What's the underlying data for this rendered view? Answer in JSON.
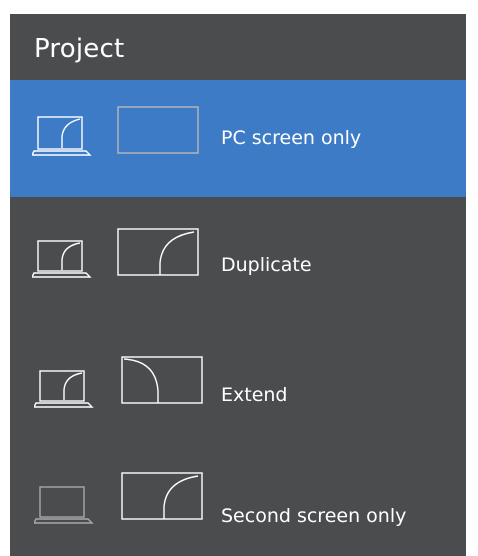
{
  "panel": {
    "title": "Project"
  },
  "options": [
    {
      "label": "PC screen only",
      "selected": true,
      "icon": "pc-screen-only-icon"
    },
    {
      "label": "Duplicate",
      "selected": false,
      "icon": "duplicate-icon"
    },
    {
      "label": "Extend",
      "selected": false,
      "icon": "extend-icon"
    },
    {
      "label": "Second screen only",
      "selected": false,
      "icon": "second-screen-only-icon"
    }
  ],
  "colors": {
    "panel_background": "#4b4c4e",
    "selected_background": "#3d7bc7",
    "text": "#ffffff",
    "dimmed_outline": "#a8a9ab"
  }
}
